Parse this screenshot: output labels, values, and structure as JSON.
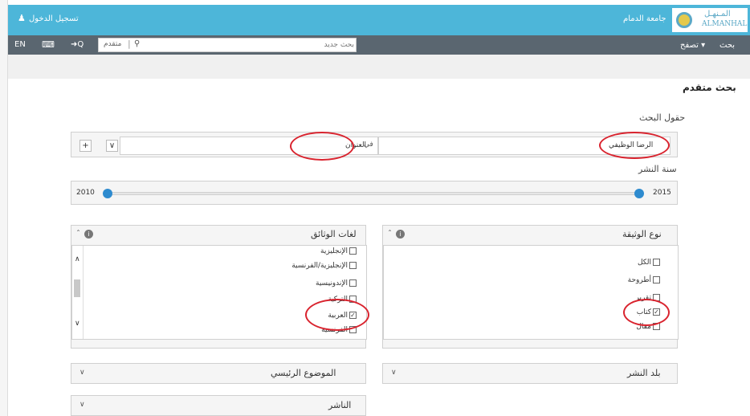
{
  "header": {
    "login_label": "تسجيل الدخول",
    "university": "جامعة الدمام",
    "logo_ar": "المـنهـل",
    "logo_en": "ALMANHAL"
  },
  "navbar": {
    "lang": "EN",
    "advanced_label": "متقدم",
    "search_placeholder": "بحث جديد",
    "browse_label": "تصفح",
    "search_label": "بحث"
  },
  "page": {
    "title": "بحث متقدم"
  },
  "search_fields": {
    "label": "حقول البحث",
    "term_value": "الرضا الوظيفي",
    "in_label": "في",
    "field_value": "العنوان",
    "add_label": "+"
  },
  "year": {
    "label": "سنة النشر",
    "min_label": "2010",
    "max_label": "2015"
  },
  "doc_languages": {
    "title": "لغات الوثائق",
    "items": [
      {
        "label": "الإنجليزية",
        "checked": false
      },
      {
        "label": "الإنجليزية/الفرنسية",
        "checked": false
      },
      {
        "label": "الإندونيسية",
        "checked": false
      },
      {
        "label": "التركية",
        "checked": false
      },
      {
        "label": "العربية",
        "checked": true
      },
      {
        "label": "الفرنسية",
        "checked": false
      }
    ]
  },
  "doc_type": {
    "title": "نوع الوثيقة",
    "items": [
      {
        "label": "الكل",
        "checked": false
      },
      {
        "label": "أطروحة",
        "checked": false
      },
      {
        "label": "تقرير",
        "checked": false
      },
      {
        "label": "كتاب",
        "checked": true
      },
      {
        "label": "مقال",
        "checked": false
      }
    ]
  },
  "dropdowns": {
    "main_subject": "الموضوع الرئيسي",
    "country": "بلد النشر",
    "publisher": "الناشر"
  },
  "colors": {
    "accent": "#4db6d9",
    "nav": "#5a6670",
    "highlight": "#d9232e",
    "slider": "#2e8bcf"
  }
}
